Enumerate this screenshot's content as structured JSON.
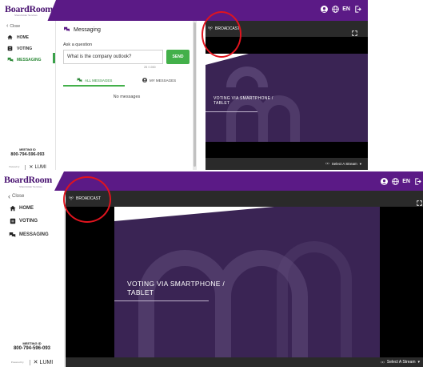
{
  "brand": {
    "logo_text": "BoardRoom",
    "logo_sub": "Shareholder Services",
    "accent": "#5b1a86",
    "active_green": "#3aa14a"
  },
  "topbar": {
    "user_icon": "user-icon",
    "globe_icon": "globe-icon",
    "language": "EN",
    "logout_icon": "logout-icon"
  },
  "sidebar": {
    "close_label": "Close",
    "items": [
      {
        "label": "HOME",
        "icon": "home-icon"
      },
      {
        "label": "VOTING",
        "icon": "voting-icon"
      },
      {
        "label": "MESSAGING",
        "icon": "chat-icon"
      }
    ],
    "meeting_label": "MEETING ID",
    "meeting_id": "800-794-596-093",
    "powered_by": "Powered by",
    "lumi": "LUMI"
  },
  "messaging": {
    "title": "Messaging",
    "ask_label": "Ask a question",
    "input_value": "What is the company outlook?",
    "send_label": "SEND",
    "counter": "28 / 1000",
    "tabs": [
      {
        "label": "ALL MESSAGES",
        "icon": "chat-icon",
        "active": true
      },
      {
        "label": "MY MESSAGES",
        "icon": "user-icon",
        "active": false
      }
    ],
    "empty_text": "No messages"
  },
  "broadcast": {
    "label": "BROADCAST",
    "icon": "broadcast-icon",
    "expand_icon": "fullscreen-icon",
    "slide_title": "VOTING VIA SMARTPHONE / TABLET",
    "slide_title_line1": "VOTING VIA SMARTPHONE /",
    "slide_title_line2": "TABLET",
    "select_stream": "Select A Stream"
  }
}
